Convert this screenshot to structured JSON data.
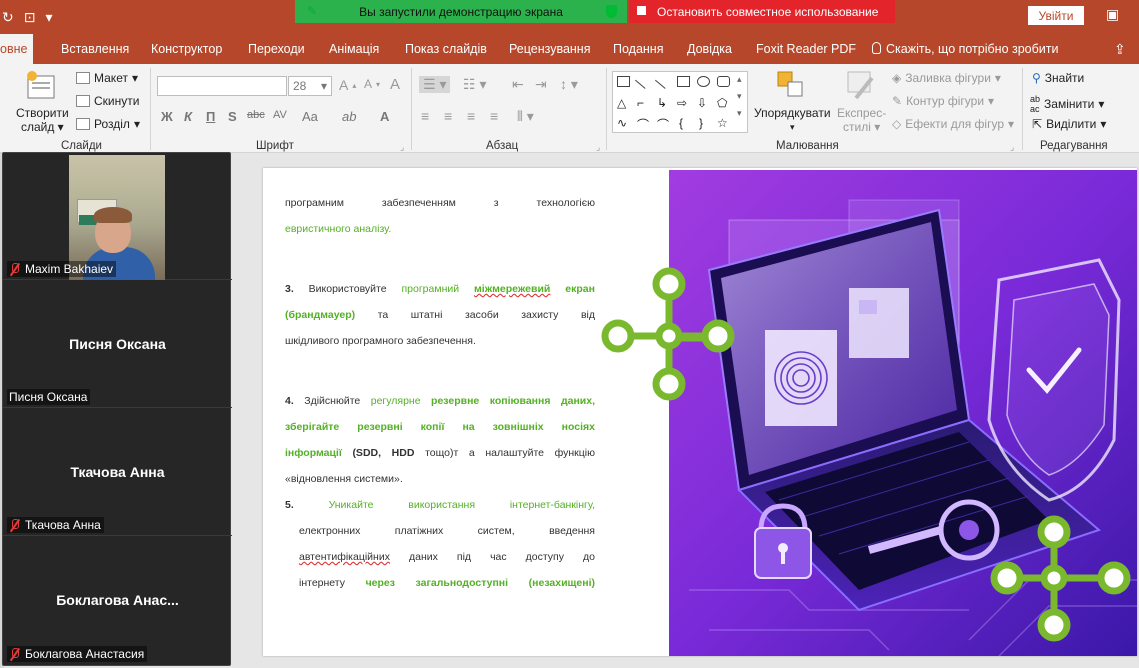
{
  "titlebar": {
    "share_banner": "Вы запустили демонстрацию экрана",
    "stop_banner": "Остановить совместное использование",
    "signin_label": "Увійти"
  },
  "tabs": [
    {
      "label": "овне",
      "active": true
    },
    {
      "label": "Вставлення"
    },
    {
      "label": "Конструктор"
    },
    {
      "label": "Переходи"
    },
    {
      "label": "Анімація"
    },
    {
      "label": "Показ слайдів"
    },
    {
      "label": "Рецензування"
    },
    {
      "label": "Подання"
    },
    {
      "label": "Довідка"
    },
    {
      "label": "Foxit Reader PDF"
    },
    {
      "label": "Скажіть, що потрібно зробити"
    }
  ],
  "ribbon": {
    "slides": {
      "new_slide_line1": "Створити",
      "new_slide_line2": "слайд",
      "layout": "Макет",
      "reset": "Скинути",
      "section": "Розділ",
      "group": "Слайди"
    },
    "font": {
      "size": "28",
      "group": "Шрифт",
      "bold": "Ж",
      "italic": "К",
      "underline": "П",
      "shadow": "S",
      "strike": "abc",
      "spacing": "AV",
      "case": "Aa",
      "color": "A"
    },
    "paragraph": {
      "group": "Абзац"
    },
    "drawing": {
      "arrange": "Упорядкувати",
      "quick_styles_line1": "Експрес-",
      "quick_styles_line2": "стилі",
      "shape_fill": "Заливка фігури",
      "shape_outline": "Контур фігури",
      "shape_effects": "Ефекти для фігур",
      "group": "Малювання"
    },
    "editing": {
      "find": "Знайти",
      "replace": "Замінити",
      "select": "Виділити",
      "group": "Редагування"
    }
  },
  "participants": [
    {
      "name": "Maxim Bakhaiev",
      "label": "Maxim Bakhaiev",
      "video": true,
      "muted": true
    },
    {
      "name": "Писня Оксана",
      "label": "Писня Оксана",
      "video": false,
      "muted": false
    },
    {
      "name": "Ткачова Анна",
      "label": "Ткачова Анна",
      "video": false,
      "muted": true
    },
    {
      "name": "Боклагова  Анас...",
      "label": "Боклагова Анастасия",
      "video": false,
      "muted": true
    }
  ],
  "slide": {
    "intro_line1": "програмним забезпеченням з технологією",
    "intro_line2": "евристичного аналізу.",
    "item3_num": "3.",
    "item3_a": "Використовуйте",
    "item3_b": "програмний",
    "item3_c": "міжмережевий",
    "item3_d": "екран",
    "item3_e": "(брандмауер)",
    "item3_f": "та штатні засоби захисту від",
    "item3_g": "шкідливого програмного забезпечення.",
    "item4_num": "4.",
    "item4_a": "Здійснюйте",
    "item4_b": "регулярне",
    "item4_c": "резервне копіювання",
    "item4_d": "даних,",
    "item4_e": "зберігайте резервні копії на зовнішніх носіях",
    "item4_f": "інформації",
    "item4_g": "(SDD, HDD",
    "item4_h": "тощо)т а налаштуйте функцію",
    "item4_i": "«відновлення системи».",
    "item5_num": "5.",
    "item5_a": "Уникайте використання інтернет-банкінгу,",
    "item5_b": "електронних платіжних систем, введення",
    "item5_c": "автентифікаційних",
    "item5_d": "даних під час доступу до",
    "item5_e": "інтернету",
    "item5_f": "через загальнодоступні (незахищені)"
  },
  "colors": {
    "accent": "#b7472a",
    "share_green": "#2bb24c",
    "stop_red": "#e3242b",
    "slide_green": "#54b026"
  }
}
